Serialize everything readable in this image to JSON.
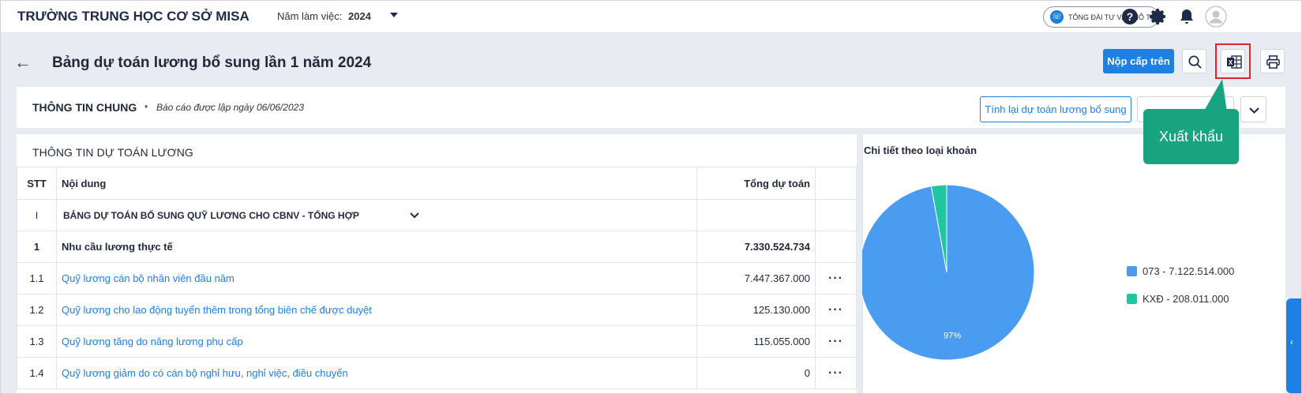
{
  "header": {
    "school_name": "TRƯỜNG TRUNG HỌC CƠ SỞ MISA",
    "year_label": "Năm làm việc:",
    "year_value": "2024",
    "hotline_label": "TỔNG ĐÀI TƯ VẤN HỖ TRỢ",
    "icons": [
      "help-icon",
      "gear-icon",
      "bell-icon",
      "avatar-icon"
    ]
  },
  "page": {
    "title": "Bảng dự toán lương bổ sung lần 1 năm 2024",
    "submit_label": "Nộp cấp trên"
  },
  "info": {
    "title": "THÔNG TIN CHUNG",
    "bullet": "•",
    "created_note": "Báo cáo được lập ngày 06/06/2023",
    "recalc_label": "Tính lại dự toán lương bổ sung"
  },
  "tooltip": {
    "text": "Xuất khẩu"
  },
  "table": {
    "title": "THÔNG TIN DỰ TOÁN LƯƠNG",
    "columns": {
      "stt": "STT",
      "content": "Nội dung",
      "total": "Tổng dự toán"
    },
    "group": {
      "stt": "I",
      "label": "BẢNG DỰ TOÁN BỔ SUNG QUỸ LƯƠNG CHO CBNV - TỔNG HỢP"
    },
    "section": {
      "stt": "1",
      "label": "Nhu cầu lương thực tế",
      "total": "7.330.524.734"
    },
    "rows": [
      {
        "stt": "1.1",
        "label": "Quỹ lương cán bộ nhân viên đầu năm",
        "total": "7.447.367.000",
        "more": "···"
      },
      {
        "stt": "1.2",
        "label": "Quỹ lương cho lao động tuyển thêm trong tổng biên chế được duyệt",
        "total": "125.130.000",
        "more": "···"
      },
      {
        "stt": "1.3",
        "label": "Quỹ lương tăng do nâng lương phụ cấp",
        "total": "115.055.000",
        "more": "···"
      },
      {
        "stt": "1.4",
        "label": "Quỹ lương giảm do có cán bộ nghỉ hưu, nghỉ việc, điều chuyển",
        "total": "0",
        "more": "···"
      }
    ]
  },
  "chart_data": {
    "type": "pie",
    "title": "Chi tiết theo loại khoản",
    "series": [
      {
        "name": "073 - 7.122.514.000",
        "value": 7122514000,
        "color": "#4a9cf0"
      },
      {
        "name": "KXĐ - 208.011.000",
        "value": 208011000,
        "color": "#1fc7a0"
      }
    ],
    "slice_labels": [
      "97%"
    ],
    "legend_position": "right"
  }
}
